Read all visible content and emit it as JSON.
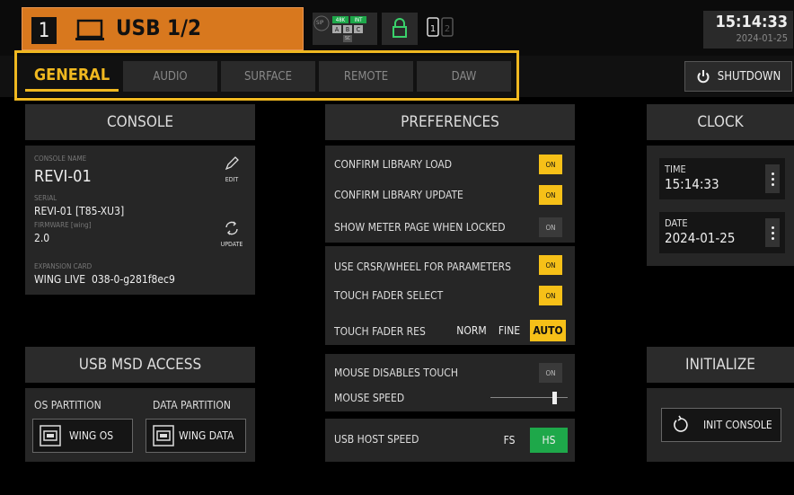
{
  "header": {
    "channel_number": "1",
    "title": "USB 1/2",
    "sample_rate_badge": "48K",
    "clock_source_badge": "INT",
    "abc_labels": [
      "A",
      "B",
      "C"
    ],
    "sc_label": "SC",
    "sip_label": "SIP",
    "time": "15:14:33",
    "date": "2024-01-25"
  },
  "tabs": [
    {
      "label": "GENERAL",
      "active": true
    },
    {
      "label": "AUDIO",
      "active": false
    },
    {
      "label": "SURFACE",
      "active": false
    },
    {
      "label": "REMOTE",
      "active": false
    },
    {
      "label": "DAW",
      "active": false
    }
  ],
  "shutdown_label": "SHUTDOWN",
  "console": {
    "header": "CONSOLE",
    "name_label": "CONSOLE NAME",
    "name_value": "REVI-01",
    "edit_label": "EDIT",
    "serial_label": "SERIAL",
    "serial_value": "REVI-01 [T85-XU3]",
    "firmware_label": "FIRMWARE [wing]",
    "firmware_value": "2.0",
    "update_label": "UPDATE",
    "expansion_label": "EXPANSION CARD",
    "expansion_value": "WING LIVE  038-0-g281f8ec9"
  },
  "usb_msd": {
    "header": "USB MSD ACCESS",
    "os_label": "OS PARTITION",
    "data_label": "DATA PARTITION",
    "os_button": "WING OS",
    "data_button": "WING DATA"
  },
  "preferences": {
    "header": "PREFERENCES",
    "confirm_load": "CONFIRM LIBRARY LOAD",
    "confirm_update": "CONFIRM LIBRARY UPDATE",
    "show_meter": "SHOW METER PAGE WHEN LOCKED",
    "use_crsr": "USE CRSR/WHEEL FOR PARAMETERS",
    "touch_select": "TOUCH FADER SELECT",
    "touch_res": "TOUCH FADER RES",
    "res_options": [
      "NORM",
      "FINE",
      "AUTO"
    ],
    "res_selected": "AUTO",
    "mouse_disables": "MOUSE DISABLES TOUCH",
    "mouse_speed": "MOUSE SPEED",
    "mouse_speed_level": 0.85,
    "usb_host_speed": "USB HOST SPEED",
    "host_options": [
      "FS",
      "HS"
    ],
    "host_selected": "HS",
    "on_label": "ON",
    "toggles": {
      "confirm_load": true,
      "confirm_update": true,
      "show_meter": false,
      "use_crsr": true,
      "touch_select": true,
      "mouse_disables": false
    }
  },
  "clock": {
    "header": "CLOCK",
    "time_label": "TIME",
    "time_value": "15:14:33",
    "date_label": "DATE",
    "date_value": "2024-01-25"
  },
  "initialize": {
    "header": "INITIALIZE",
    "button": "INIT CONSOLE"
  },
  "colors": {
    "accent": "#f0b820",
    "toggle_on": "#f6c018",
    "channel_orange": "#d8781e",
    "hs_green": "#1ea84a"
  }
}
